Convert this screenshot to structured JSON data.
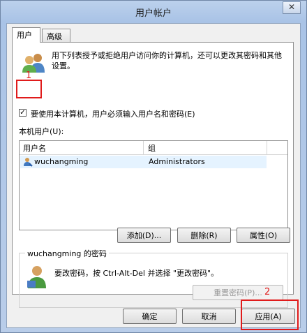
{
  "window": {
    "title": "用户帐户",
    "close_label": "✕"
  },
  "tabs": [
    {
      "label": "用户"
    },
    {
      "label": "高级"
    }
  ],
  "description": "用下列表授予或拒绝用户访问你的计算机，还可以更改其密码和其他设置。",
  "require_login": {
    "label": "要使用本计算机，用户必须输入用户名和密码(E)",
    "checked": true,
    "mark": "✓"
  },
  "users_label": "本机用户(U):",
  "user_table": {
    "columns": [
      "用户名",
      "组"
    ],
    "rows": [
      {
        "name": "wuchangming",
        "group": "Administrators"
      }
    ]
  },
  "user_buttons": {
    "add": "添加(D)...",
    "remove": "删除(R)",
    "properties": "属性(O)"
  },
  "password_group": {
    "title": "wuchangming 的密码",
    "text": "要改密码，按 Ctrl-Alt-Del 并选择 \"更改密码\"。",
    "reset_button": "重置密码(P)..."
  },
  "dialog_buttons": {
    "ok": "确定",
    "cancel": "取消",
    "apply": "应用(A)"
  },
  "annotations": {
    "one": "1",
    "two": "2",
    "color": "#e01b1b"
  }
}
